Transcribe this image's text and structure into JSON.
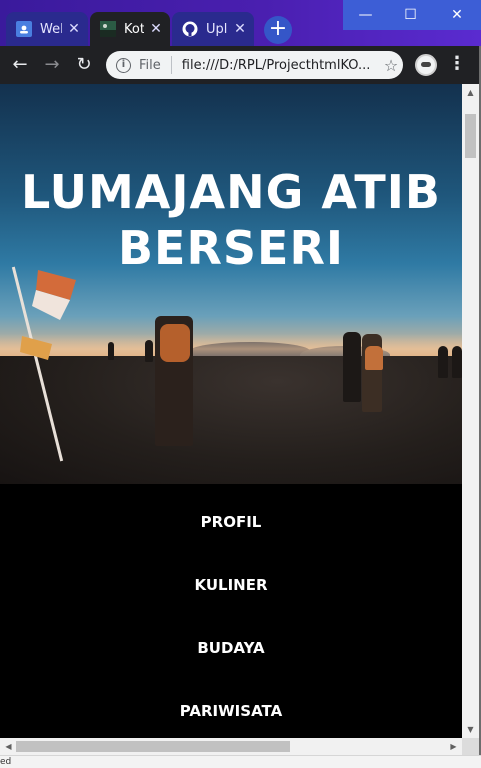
{
  "browser": {
    "tabs": [
      {
        "label": "Wel",
        "favicon": "contacts-icon",
        "active": false
      },
      {
        "label": "Kot",
        "favicon": "landscape-image-icon",
        "active": true
      },
      {
        "label": "Upl",
        "favicon": "github-icon",
        "active": false
      }
    ],
    "tab_close_glyph": "✕",
    "new_tab_glyph": "+",
    "window_controls": {
      "minimize": "—",
      "maximize": "☐",
      "close": "✕"
    },
    "address": {
      "scheme_label": "File",
      "url": "file:///D:/RPL/ProjecthtmlKO..."
    },
    "icons": {
      "back": "←",
      "forward": "→",
      "reload": "↻",
      "info": "i",
      "star": "☆",
      "menu": "⋮"
    }
  },
  "page": {
    "hero": {
      "title_line1": "LUMAJANG ATIB",
      "title_line2": "BERSERI"
    },
    "nav": [
      {
        "label": "PROFIL"
      },
      {
        "label": "KULINER"
      },
      {
        "label": "BUDAYA"
      },
      {
        "label": "PARIWISATA"
      }
    ]
  },
  "scrollbars": {
    "up": "▲",
    "down": "▼",
    "left": "◀",
    "right": "▶"
  },
  "status": {
    "text": "ed"
  },
  "colors": {
    "tabstrip": "#4a1fb0",
    "toolbar": "#202124",
    "page_bg": "#000000",
    "text_white": "#ffffff"
  }
}
